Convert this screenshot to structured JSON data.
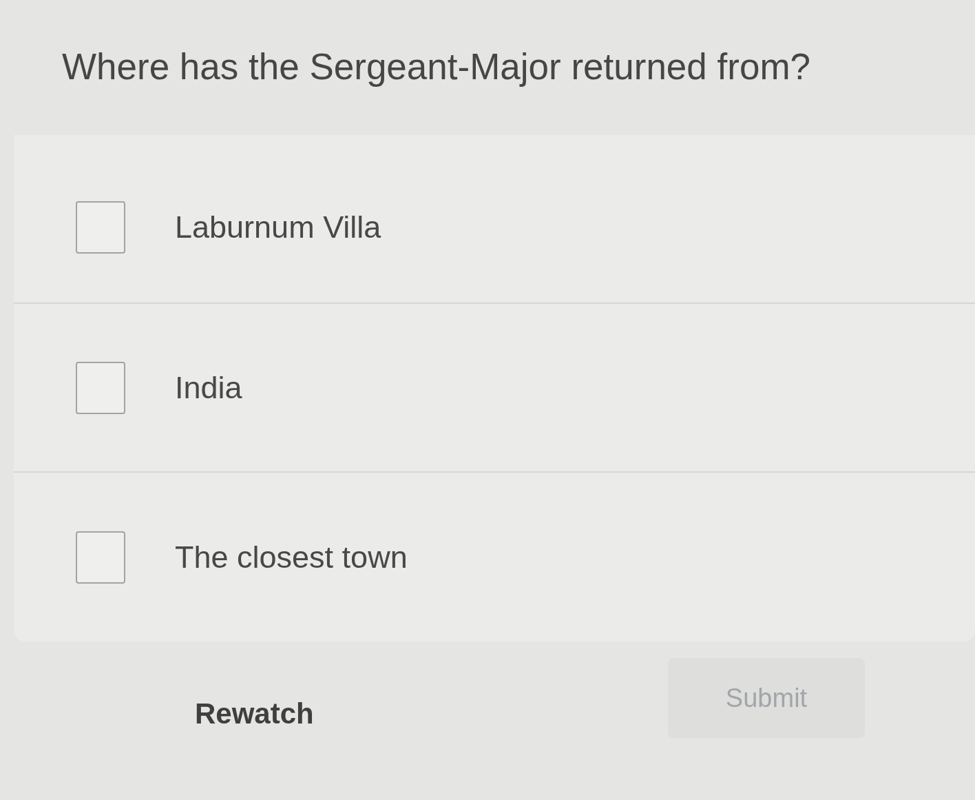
{
  "question": "Where has the Sergeant-Major returned from?",
  "options": [
    {
      "label": "Laburnum Villa",
      "checked": false
    },
    {
      "label": "India",
      "checked": false
    },
    {
      "label": "The closest town",
      "checked": false
    }
  ],
  "buttons": [
    {
      "label": "Rewatch",
      "kind": "text",
      "disabled": false
    },
    {
      "label": "Submit",
      "kind": "filled",
      "disabled": true
    }
  ]
}
